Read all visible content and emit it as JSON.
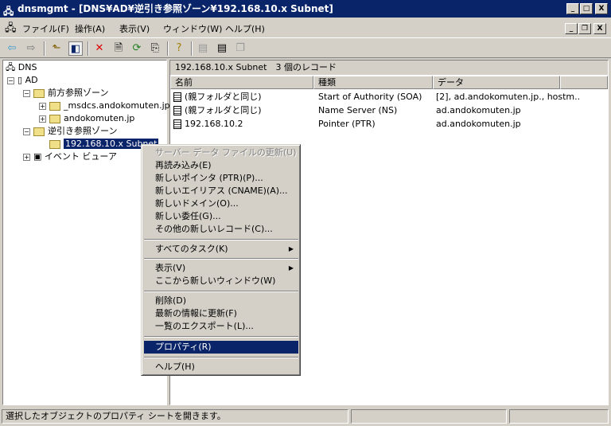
{
  "title": "dnsmgmt - [DNS¥AD¥逆引き参照ゾーン¥192.168.10.x Subnet]",
  "window_buttons": {
    "minimize": "_",
    "maximize": "□",
    "close": "X"
  },
  "mdi_buttons": {
    "minimize": "_",
    "restore": "❐",
    "close": "X"
  },
  "menu": [
    "ファイル(F)",
    "操作(A)",
    "表示(V)",
    "ウィンドウ(W)",
    "ヘルプ(H)"
  ],
  "tree": {
    "root": "DNS",
    "server": "AD",
    "forward": "前方参照ゾーン",
    "fz1": "_msdcs.andokomuten.jp",
    "fz2": "andokomuten.jp",
    "reverse": "逆引き参照ゾーン",
    "rz1": "192.168.10.x Subnet",
    "events": "イベント ビューア"
  },
  "list": {
    "header": "192.168.10.x Subnet　3 個のレコード",
    "columns": [
      "名前",
      "種類",
      "データ"
    ],
    "rows": [
      {
        "name": "(親フォルダと同じ)",
        "type": "Start of Authority (SOA)",
        "data": "[2], ad.andokomuten.jp., hostm.."
      },
      {
        "name": "(親フォルダと同じ)",
        "type": "Name Server (NS)",
        "data": "ad.andokomuten.jp"
      },
      {
        "name": "192.168.10.2",
        "type": "Pointer (PTR)",
        "data": "ad.andokomuten.jp"
      }
    ]
  },
  "context_menu": [
    "サーバー データ ファイルの更新(U)",
    "再読み込み(E)",
    "新しいポインタ (PTR)(P)...",
    "新しいエイリアス (CNAME)(A)...",
    "新しいドメイン(O)...",
    "新しい委任(G)...",
    "その他の新しいレコード(C)...",
    "すべてのタスク(K)",
    "表示(V)",
    "ここから新しいウィンドウ(W)",
    "削除(D)",
    "最新の情報に更新(F)",
    "一覧のエクスポート(L)...",
    "プロパティ(R)",
    "ヘルプ(H)"
  ],
  "status": "選択したオブジェクトのプロパティ シートを開きます。"
}
